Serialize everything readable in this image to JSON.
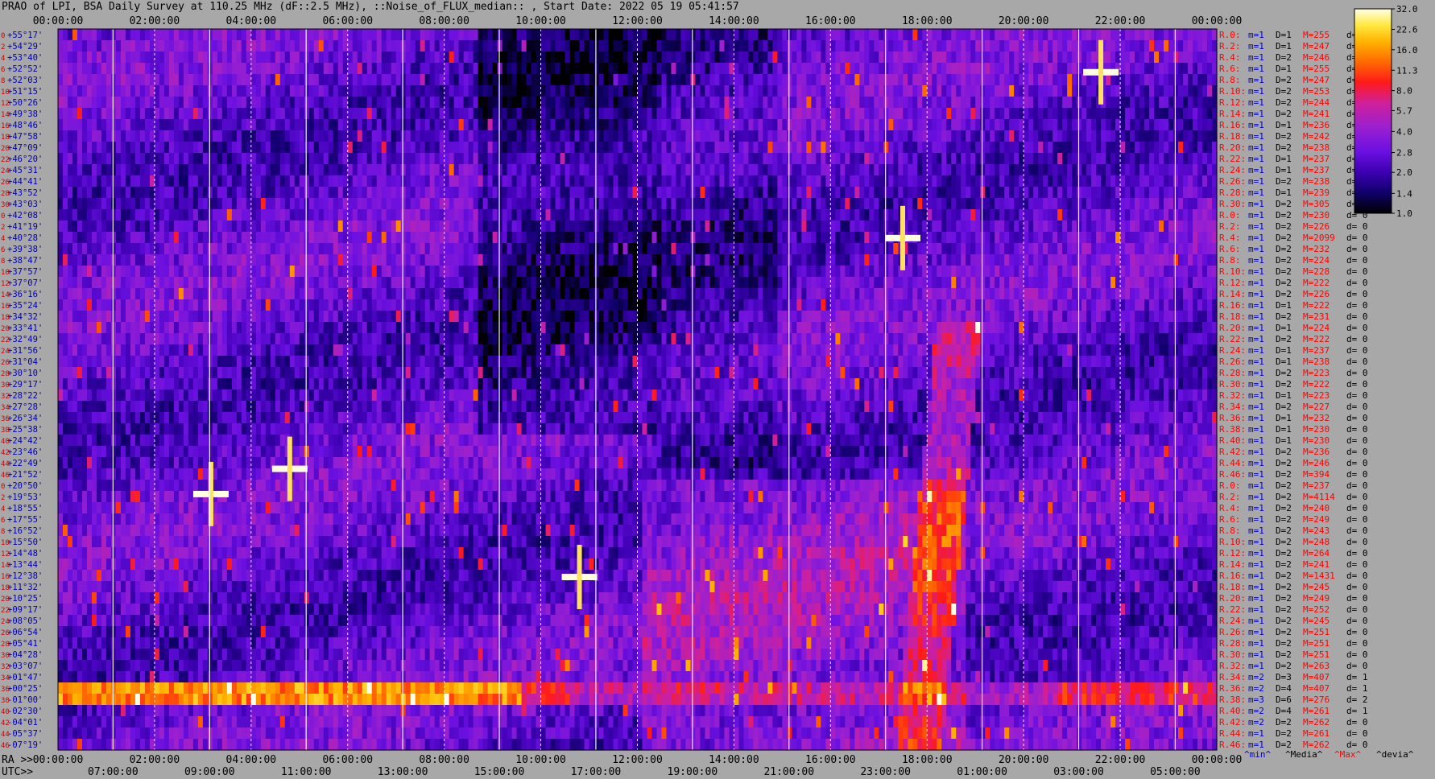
{
  "title": "PRAO of LPI, BSA Daily Survey at 110.25 MHz (dF::2.5 MHz), ::Noise_of_FLUX_median:: , Start Date: 2022 05 19 05:41:57",
  "chart_data": {
    "type": "heatmap",
    "top_axis_ticks": [
      "00:00:00",
      "02:00:00",
      "04:00:00",
      "06:00:00",
      "08:00:00",
      "10:00:00",
      "12:00:00",
      "14:00:00",
      "16:00:00",
      "18:00:00",
      "20:00:00",
      "22:00:00",
      "00:00:00"
    ],
    "bottom_ra_prefix": "RA >>",
    "bottom_ra_ticks": [
      "00:00:00",
      "02:00:00",
      "04:00:00",
      "06:00:00",
      "08:00:00",
      "10:00:00",
      "12:00:00",
      "14:00:00",
      "16:00:00",
      "18:00:00",
      "20:00:00",
      "22:00:00",
      "00:00:00"
    ],
    "bottom_utc_prefix": "UTC>>",
    "bottom_utc_ticks": [
      "07:00:00",
      "09:00:00",
      "11:00:00",
      "13:00:00",
      "15:00:00",
      "17:00:00",
      "19:00:00",
      "21:00:00",
      "23:00:00",
      "01:00:00",
      "03:00:00",
      "05:00:00"
    ],
    "dec_labels": [
      "+55°17'",
      "+54°29'",
      "+53°40'",
      "+52°52'",
      "+52°03'",
      "+51°15'",
      "+50°26'",
      "+49°38'",
      "+48°46'",
      "+47°58'",
      "+47°09'",
      "+46°20'",
      "+45°31'",
      "+44°41'",
      "+43°52'",
      "+43°03'",
      "+42°08'",
      "+41°19'",
      "+40°28'",
      "+39°38'",
      "+38°47'",
      "+37°57'",
      "+37°07'",
      "+36°16'",
      "+35°24'",
      "+34°32'",
      "+33°41'",
      "+32°49'",
      "+31°56'",
      "+31°04'",
      "+30°10'",
      "+29°17'",
      "+28°22'",
      "+27°28'",
      "+26°34'",
      "+25°38'",
      "+24°42'",
      "+23°46'",
      "+22°49'",
      "+21°52'",
      "+20°50'",
      "+19°53'",
      "+18°55'",
      "+17°55'",
      "+16°52'",
      "+15°50'",
      "+14°48'",
      "+13°44'",
      "+12°38'",
      "+11°32'",
      "+10°25'",
      "+09°17'",
      "+08°05'",
      "+06°54'",
      "+05°41'",
      "+04°28'",
      "+03°07'",
      "+01°47'",
      "+00°25'",
      "-01°00'",
      "-02°30'",
      "-04°01'",
      "-05°37'",
      "-07°19'"
    ],
    "row_index_labels": [
      "0",
      "2",
      "4",
      "6",
      "8",
      "10",
      "12",
      "14",
      "16",
      "18",
      "20",
      "22",
      "24",
      "26",
      "28",
      "30",
      "0",
      "2",
      "4",
      "6",
      "8",
      "10",
      "12",
      "14",
      "16",
      "18",
      "20",
      "22",
      "24",
      "26",
      "28",
      "30",
      "32",
      "34",
      "36",
      "38",
      "40",
      "42",
      "44",
      "46",
      "0",
      "2",
      "4",
      "6",
      "8",
      "10",
      "12",
      "14",
      "16",
      "18",
      "20",
      "22",
      "24",
      "26",
      "28",
      "30",
      "32",
      "34",
      "36",
      "38",
      "40",
      "42",
      "44",
      "46"
    ],
    "stats_rows": [
      {
        "r": "R.0:",
        "m": "m=1",
        "D": "D=1",
        "M": "M=255",
        "d": "d= 0"
      },
      {
        "r": "R.2:",
        "m": "m=1",
        "D": "D=1",
        "M": "M=247",
        "d": "d= 0"
      },
      {
        "r": "R.4:",
        "m": "m=1",
        "D": "D=2",
        "M": "M=246",
        "d": "d= 0"
      },
      {
        "r": "R.6:",
        "m": "m=1",
        "D": "D=1",
        "M": "M=255",
        "d": "d= 0"
      },
      {
        "r": "R.8:",
        "m": "m=1",
        "D": "D=2",
        "M": "M=247",
        "d": "d= 0"
      },
      {
        "r": "R.10:",
        "m": "m=1",
        "D": "D=2",
        "M": "M=253",
        "d": "d= 0"
      },
      {
        "r": "R.12:",
        "m": "m=1",
        "D": "D=2",
        "M": "M=244",
        "d": "d= 0"
      },
      {
        "r": "R.14:",
        "m": "m=1",
        "D": "D=2",
        "M": "M=241",
        "d": "d= 0"
      },
      {
        "r": "R.16:",
        "m": "m=1",
        "D": "D=1",
        "M": "M=236",
        "d": "d= 0"
      },
      {
        "r": "R.18:",
        "m": "m=1",
        "D": "D=2",
        "M": "M=242",
        "d": "d= 0"
      },
      {
        "r": "R.20:",
        "m": "m=1",
        "D": "D=2",
        "M": "M=238",
        "d": "d= 0"
      },
      {
        "r": "R.22:",
        "m": "m=1",
        "D": "D=1",
        "M": "M=237",
        "d": "d= 0"
      },
      {
        "r": "R.24:",
        "m": "m=1",
        "D": "D=1",
        "M": "M=237",
        "d": "d= 0"
      },
      {
        "r": "R.26:",
        "m": "m=1",
        "D": "D=2",
        "M": "M=238",
        "d": "d= 0"
      },
      {
        "r": "R.28:",
        "m": "m=1",
        "D": "D=1",
        "M": "M=239",
        "d": "d= 0"
      },
      {
        "r": "R.30:",
        "m": "m=1",
        "D": "D=2",
        "M": "M=305",
        "d": "d= 0"
      },
      {
        "r": "R.0:",
        "m": "m=1",
        "D": "D=2",
        "M": "M=230",
        "d": "d= 0"
      },
      {
        "r": "R.2:",
        "m": "m=1",
        "D": "D=2",
        "M": "M=226",
        "d": "d= 0"
      },
      {
        "r": "R.4:",
        "m": "m=1",
        "D": "D=2",
        "M": "M=2099",
        "d": "d= 0"
      },
      {
        "r": "R.6:",
        "m": "m=1",
        "D": "D=2",
        "M": "M=232",
        "d": "d= 0"
      },
      {
        "r": "R.8:",
        "m": "m=1",
        "D": "D=2",
        "M": "M=224",
        "d": "d= 0"
      },
      {
        "r": "R.10:",
        "m": "m=1",
        "D": "D=2",
        "M": "M=228",
        "d": "d= 0"
      },
      {
        "r": "R.12:",
        "m": "m=1",
        "D": "D=2",
        "M": "M=222",
        "d": "d= 0"
      },
      {
        "r": "R.14:",
        "m": "m=1",
        "D": "D=2",
        "M": "M=226",
        "d": "d= 0"
      },
      {
        "r": "R.16:",
        "m": "m=1",
        "D": "D=1",
        "M": "M=222",
        "d": "d= 0"
      },
      {
        "r": "R.18:",
        "m": "m=1",
        "D": "D=2",
        "M": "M=231",
        "d": "d= 0"
      },
      {
        "r": "R.20:",
        "m": "m=1",
        "D": "D=1",
        "M": "M=224",
        "d": "d= 0"
      },
      {
        "r": "R.22:",
        "m": "m=1",
        "D": "D=2",
        "M": "M=222",
        "d": "d= 0"
      },
      {
        "r": "R.24:",
        "m": "m=1",
        "D": "D=1",
        "M": "M=237",
        "d": "d= 0"
      },
      {
        "r": "R.26:",
        "m": "m=1",
        "D": "D=1",
        "M": "M=238",
        "d": "d= 0"
      },
      {
        "r": "R.28:",
        "m": "m=1",
        "D": "D=2",
        "M": "M=223",
        "d": "d= 0"
      },
      {
        "r": "R.30:",
        "m": "m=1",
        "D": "D=2",
        "M": "M=222",
        "d": "d= 0"
      },
      {
        "r": "R.32:",
        "m": "m=1",
        "D": "D=1",
        "M": "M=223",
        "d": "d= 0"
      },
      {
        "r": "R.34:",
        "m": "m=1",
        "D": "D=2",
        "M": "M=227",
        "d": "d= 0"
      },
      {
        "r": "R.36:",
        "m": "m=1",
        "D": "D=1",
        "M": "M=232",
        "d": "d= 0"
      },
      {
        "r": "R.38:",
        "m": "m=1",
        "D": "D=1",
        "M": "M=230",
        "d": "d= 0"
      },
      {
        "r": "R.40:",
        "m": "m=1",
        "D": "D=1",
        "M": "M=230",
        "d": "d= 0"
      },
      {
        "r": "R.42:",
        "m": "m=1",
        "D": "D=2",
        "M": "M=236",
        "d": "d= 0"
      },
      {
        "r": "R.44:",
        "m": "m=1",
        "D": "D=2",
        "M": "M=246",
        "d": "d= 0"
      },
      {
        "r": "R.46:",
        "m": "m=1",
        "D": "D=2",
        "M": "M=394",
        "d": "d= 0"
      },
      {
        "r": "R.0:",
        "m": "m=1",
        "D": "D=2",
        "M": "M=237",
        "d": "d= 0"
      },
      {
        "r": "R.2:",
        "m": "m=1",
        "D": "D=2",
        "M": "M=4114",
        "d": "d= 0"
      },
      {
        "r": "R.4:",
        "m": "m=1",
        "D": "D=2",
        "M": "M=240",
        "d": "d= 0"
      },
      {
        "r": "R.6:",
        "m": "m=1",
        "D": "D=2",
        "M": "M=249",
        "d": "d= 0"
      },
      {
        "r": "R.8:",
        "m": "m=1",
        "D": "D=2",
        "M": "M=243",
        "d": "d= 0"
      },
      {
        "r": "R.10:",
        "m": "m=1",
        "D": "D=2",
        "M": "M=248",
        "d": "d= 0"
      },
      {
        "r": "R.12:",
        "m": "m=1",
        "D": "D=2",
        "M": "M=264",
        "d": "d= 0"
      },
      {
        "r": "R.14:",
        "m": "m=1",
        "D": "D=2",
        "M": "M=241",
        "d": "d= 0"
      },
      {
        "r": "R.16:",
        "m": "m=1",
        "D": "D=2",
        "M": "M=1431",
        "d": "d= 0"
      },
      {
        "r": "R.18:",
        "m": "m=1",
        "D": "D=2",
        "M": "M=245",
        "d": "d= 0"
      },
      {
        "r": "R.20:",
        "m": "m=1",
        "D": "D=2",
        "M": "M=249",
        "d": "d= 0"
      },
      {
        "r": "R.22:",
        "m": "m=1",
        "D": "D=2",
        "M": "M=252",
        "d": "d= 0"
      },
      {
        "r": "R.24:",
        "m": "m=1",
        "D": "D=2",
        "M": "M=245",
        "d": "d= 0"
      },
      {
        "r": "R.26:",
        "m": "m=1",
        "D": "D=2",
        "M": "M=251",
        "d": "d= 0"
      },
      {
        "r": "R.28:",
        "m": "m=1",
        "D": "D=2",
        "M": "M=251",
        "d": "d= 0"
      },
      {
        "r": "R.30:",
        "m": "m=1",
        "D": "D=2",
        "M": "M=251",
        "d": "d= 0"
      },
      {
        "r": "R.32:",
        "m": "m=1",
        "D": "D=2",
        "M": "M=263",
        "d": "d= 0"
      },
      {
        "r": "R.34:",
        "m": "m=2",
        "D": "D=3",
        "M": "M=407",
        "d": "d= 1"
      },
      {
        "r": "R.36:",
        "m": "m=2",
        "D": "D=4",
        "M": "M=407",
        "d": "d= 1"
      },
      {
        "r": "R.38:",
        "m": "m=3",
        "D": "D=6",
        "M": "M=276",
        "d": "d= 2"
      },
      {
        "r": "R.40:",
        "m": "m=2",
        "D": "D=4",
        "M": "M=261",
        "d": "d= 1"
      },
      {
        "r": "R.42:",
        "m": "m=2",
        "D": "D=2",
        "M": "M=262",
        "d": "d= 0"
      },
      {
        "r": "R.44:",
        "m": "m=1",
        "D": "D=2",
        "M": "M=261",
        "d": "d= 0"
      },
      {
        "r": "R.46:",
        "m": "m=1",
        "D": "D=2",
        "M": "M=262",
        "d": "d= 0"
      }
    ],
    "stats_footer": [
      "^min^",
      "^Media^",
      "^Max^",
      "^devia^"
    ],
    "colorbar_ticks": [
      "32.0",
      "22.6",
      "16.0",
      "11.3",
      "8.0",
      "5.7",
      "4.0",
      "2.8",
      "2.0",
      "1.4",
      "1.0"
    ],
    "colorbar_range": [
      1.0,
      32.0
    ],
    "colorbar_scale": "log",
    "colors": {
      "background": "#a8a8a8",
      "stat_label_red": "#ff0000",
      "stat_value_blue": "#0000cc",
      "dec_label_blue": "#0000b0",
      "index_label_red": "#d00000",
      "grid_white": "#ffffff"
    }
  }
}
